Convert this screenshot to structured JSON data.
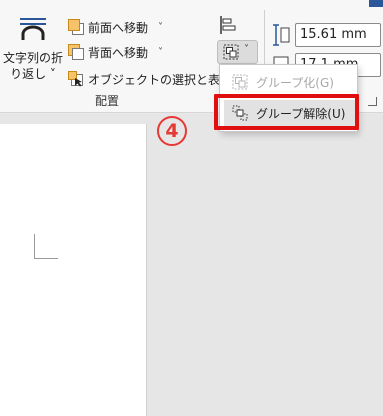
{
  "colors": {
    "accent_red": "#e53935",
    "highlight_red": "#e01010",
    "ribbon_bg": "#f7f7f7"
  },
  "ribbon": {
    "wrap_text": {
      "label_line1": "文字列の折",
      "label_line2": "り返し ˅",
      "icon": "wrap-text-icon"
    },
    "bring_forward": {
      "label": "前面へ移動",
      "icon": "bring-forward-icon",
      "chevron": "˅"
    },
    "send_backward": {
      "label": "背面へ移動",
      "icon": "send-backward-icon",
      "chevron": "˅"
    },
    "selection_pane": {
      "label": "オブジェクトの選択と表示",
      "icon": "selection-pane-icon"
    },
    "group_label": "配置",
    "align_icon": "align-icon",
    "group_icon": "group-objects-icon",
    "height_value": "15.61 mm",
    "width_value": "17.1 mm"
  },
  "step_marker": "4",
  "dropdown": {
    "group": {
      "label": "グループ化(G)",
      "enabled": false,
      "icon": "group-icon"
    },
    "ungroup": {
      "label": "グループ解除(U)",
      "enabled": true,
      "icon": "ungroup-icon"
    }
  }
}
